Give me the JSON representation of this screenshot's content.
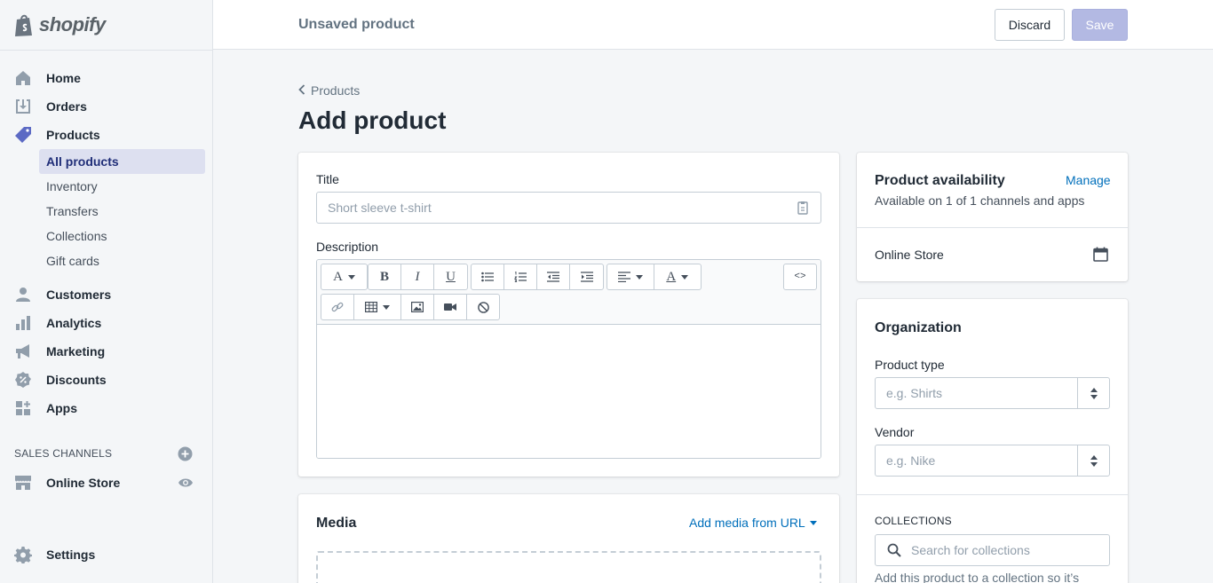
{
  "brand": {
    "name": "shopify"
  },
  "sidebar": {
    "items": [
      {
        "label": "Home",
        "icon": "home-icon"
      },
      {
        "label": "Orders",
        "icon": "orders-icon"
      },
      {
        "label": "Products",
        "icon": "tag-icon"
      }
    ],
    "product_sub": [
      {
        "label": "All products",
        "active": true
      },
      {
        "label": "Inventory"
      },
      {
        "label": "Transfers"
      },
      {
        "label": "Collections"
      },
      {
        "label": "Gift cards"
      }
    ],
    "items2": [
      {
        "label": "Customers",
        "icon": "customers-icon"
      },
      {
        "label": "Analytics",
        "icon": "analytics-icon"
      },
      {
        "label": "Marketing",
        "icon": "marketing-icon"
      },
      {
        "label": "Discounts",
        "icon": "discounts-icon"
      },
      {
        "label": "Apps",
        "icon": "apps-icon"
      }
    ],
    "sales_channels_label": "SALES CHANNELS",
    "online_store": "Online Store",
    "settings": "Settings"
  },
  "topbar": {
    "title": "Unsaved product",
    "discard": "Discard",
    "save": "Save"
  },
  "main": {
    "breadcrumb": "Products",
    "page_title": "Add product",
    "title_label": "Title",
    "title_placeholder": "Short sleeve t-shirt",
    "description_label": "Description",
    "media_title": "Media",
    "add_media_url": "Add media from URL"
  },
  "availability": {
    "title": "Product availability",
    "manage": "Manage",
    "subtitle": "Available on 1 of 1 channels and apps",
    "channel": "Online Store"
  },
  "organization": {
    "title": "Organization",
    "product_type_label": "Product type",
    "product_type_placeholder": "e.g. Shirts",
    "vendor_label": "Vendor",
    "vendor_placeholder": "e.g. Nike",
    "collections_label": "COLLECTIONS",
    "collections_placeholder": "Search for collections",
    "collections_help": "Add this product to a collection so it’s"
  },
  "colors": {
    "accent": "#5c6ac4",
    "link": "#006fbb",
    "save_disabled": "#b3b9e3"
  }
}
